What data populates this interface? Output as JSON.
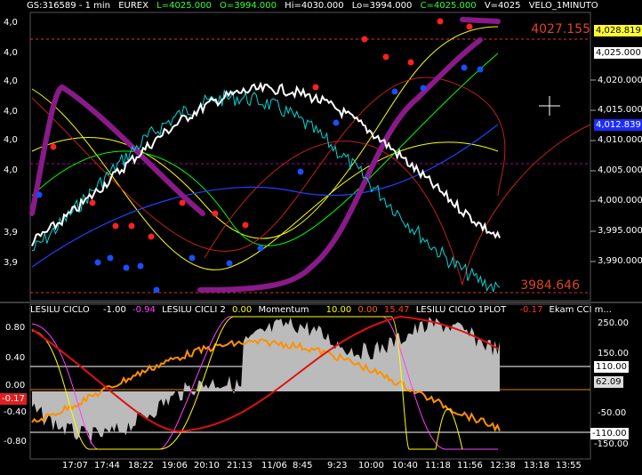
{
  "header": {
    "symbol": "GS:316589 - 1 min",
    "exchange": "EUREX",
    "low": "L=4025.000",
    "open": "O=3994.000",
    "high": "Hi=4030.000",
    "lo": "Lo=3994.000",
    "close": "C=4025.000",
    "volume": "V=4025",
    "study": "VELO_1MINUTO"
  },
  "price_axis": {
    "left_labels": [
      "4,0",
      "4,0",
      "4,0",
      "4,0",
      "4,0",
      "4,0",
      "3,9",
      "3,9"
    ],
    "right_labels": [
      "4,020.000",
      "4,015.000",
      "4,010.000",
      "4,005.000",
      "4,000.000",
      "3,995.000",
      "3,990.000"
    ],
    "current_price_box": "4,025.000",
    "highlight_box": "4,028.819",
    "blue_box": "4,012.839"
  },
  "levels": {
    "upper": "4027.155",
    "lower": "3984.646"
  },
  "indicator_header": {
    "name1": "LESILU CICLO",
    "val1a": "-1.00",
    "val1b": "-0.94",
    "name2": "LESILU CICLI 2",
    "val2": "0.00",
    "name3": "Momentum",
    "val3a": "10.00",
    "val3b": "0.00",
    "val3c": "15.47",
    "name4": "LESILU CICLO 1PLOT",
    "val4": "-0.17",
    "name5": "Ekam CCI m..."
  },
  "indicator_axis": {
    "left_labels": [
      "0.80",
      "0.40",
      "0.00",
      "-0.40",
      "-0.80"
    ],
    "left_marker": "-0.17",
    "right_labels": [
      "250.00",
      "150.00",
      "-50.00",
      "-150.00"
    ],
    "box_110": "110.00",
    "box_6209": "62.09",
    "box_neg110": "-110.00"
  },
  "time_axis": [
    "17:07",
    "17:44",
    "18:22",
    "19:06",
    "20:10",
    "21:13",
    "11/06",
    "8:45",
    "9:23",
    "10:00",
    "10:40",
    "11:18",
    "11:56",
    "12:38",
    "13:18",
    "13:55"
  ],
  "colors": {
    "price": "#ffffff",
    "velo": "#00d8d8",
    "purple_band": "#8a1a8a",
    "dot_red": "#ff2020",
    "dot_blue": "#1a4dff",
    "level_red": "#e03030"
  }
}
